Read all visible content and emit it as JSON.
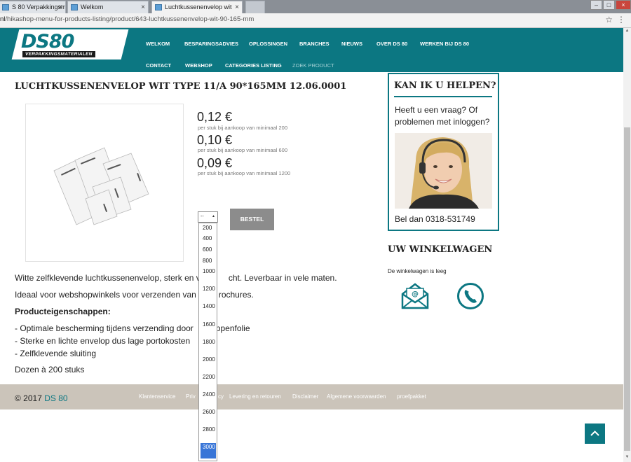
{
  "browser": {
    "tabs": [
      {
        "label": "S 80 Verpakkingsmate",
        "active": false
      },
      {
        "label": "Welkom",
        "active": false
      },
      {
        "label": "Luchtkussenenvelop wit",
        "active": true
      }
    ],
    "url_prefix": "nl",
    "url_path": "/hikashop-menu-for-products-listing/product/643-luchtkussenenvelop-wit-90-165-mm"
  },
  "logo": {
    "brand": "DS80",
    "tagline": "VERPAKKINGSMATERIALEN"
  },
  "nav": {
    "row1": [
      "WELKOM",
      "BESPARINGSADVIES",
      "OPLOSSINGEN",
      "BRANCHES",
      "NIEUWS",
      "OVER DS 80",
      "WERKEN BIJ DS 80"
    ],
    "row2": [
      "CONTACT",
      "WEBSHOP",
      "CATEGORIES LISTING",
      "ZOEK PRODUCT"
    ]
  },
  "product": {
    "title": "LUCHTKUSSENENVELOP WIT TYPE 11/A 90*165MM 12.06.0001",
    "prices": [
      {
        "value": "0,12 €",
        "note": "per stuk bij aankoop van minimaal 200"
      },
      {
        "value": "0,10 €",
        "note": "per stuk bij aankoop van minimaal 600"
      },
      {
        "value": "0,09 €",
        "note": "per stuk bij aankoop van minimaal 1200"
      }
    ],
    "quantity_selected": "--",
    "quantity_options": [
      "200",
      "400",
      "600",
      "800",
      "1000",
      "1200",
      "1400",
      "1600",
      "1800",
      "2000",
      "2200",
      "2400",
      "2600",
      "2800",
      "3000"
    ],
    "quantity_highlighted": "3000",
    "order_button": "BESTEL",
    "description": {
      "line1_a": "Witte zelfklevende luchtkussenenvelop, sterk en v",
      "line1_b": "cht. Leverbaar in vele maten.",
      "line2_a": "Ideaal voor webshopwinkels voor verzenden van",
      "line2_b": "rochures.",
      "props_heading": "Producteigenschappen:",
      "bullet1_a": "- Optimale bescherming tijdens verzending door",
      "bullet1_b": "ppenfolie",
      "bullet2": "- Sterke en lichte envelop dus lage portokosten",
      "bullet3": "- Zelfklevende sluiting",
      "packaging": "Dozen à 200 stuks"
    }
  },
  "help": {
    "title": "KAN IK U HELPEN?",
    "text": "Heeft u een vraag? Of problemen met inloggen?",
    "phone": "Bel dan 0318-531749"
  },
  "cart": {
    "title": "UW WINKELWAGEN",
    "empty": "De winkelwagen is leeg"
  },
  "footer": {
    "copyright": "© 2017",
    "brand": "DS 80",
    "links": [
      "Klantenservice",
      "Priv",
      "cy",
      "Levering en retouren",
      "Disclaimer",
      "Algemene voorwaarden",
      "proefpakket"
    ]
  },
  "colors": {
    "accent": "#0c7782",
    "footer": "#cbc4ba",
    "selected": "#3875d7"
  }
}
